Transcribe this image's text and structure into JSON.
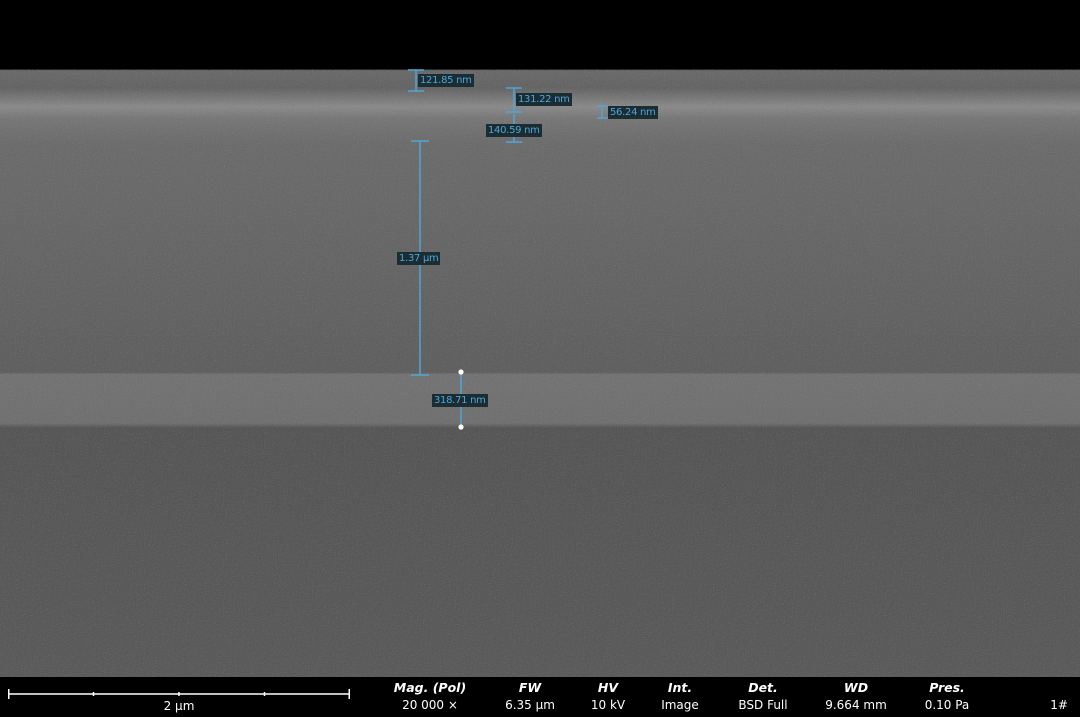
{
  "measurements": [
    {
      "id": "m1",
      "value": "121.85 nm"
    },
    {
      "id": "m2",
      "value": "131.22 nm"
    },
    {
      "id": "m3",
      "value": "56.24 nm"
    },
    {
      "id": "m4",
      "value": "140.59 nm"
    },
    {
      "id": "m5",
      "value": "1.37 µm"
    },
    {
      "id": "m6",
      "value": "318.71 nm"
    }
  ],
  "scale_bar": {
    "label": "2 µm"
  },
  "params": {
    "mag": {
      "header": "Mag. (Pol)",
      "value": "20 000 ×"
    },
    "fw": {
      "header": "FW",
      "value": "6.35 µm"
    },
    "hv": {
      "header": "HV",
      "value": "10 kV"
    },
    "int": {
      "header": "Int.",
      "value": "Image"
    },
    "det": {
      "header": "Det.",
      "value": "BSD Full"
    },
    "wd": {
      "header": "WD",
      "value": "9.664 mm"
    },
    "pres": {
      "header": "Pres.",
      "value": "0.10 Pa"
    }
  },
  "frame_id": "1#",
  "colors": {
    "measurement": "#4fa6d8",
    "label_bg": "#1b2c33"
  }
}
